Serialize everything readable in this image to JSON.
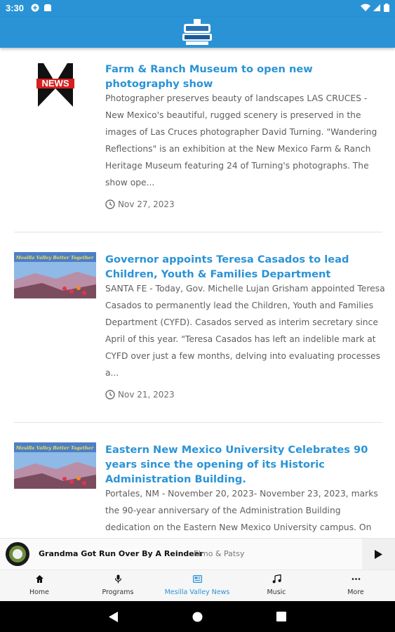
{
  "status": {
    "time": "3:30"
  },
  "articles": [
    {
      "title": "Farm & Ranch Museum to open new photography show",
      "excerpt": "Photographer preserves beauty of landscapes LAS CRUCES - New Mexico's beautiful, rugged scenery is preserved in the images of Las Cruces photographer David Turning. \"Wandering Reflections\" is an exhibition at the New Mexico Farm & Ranch Heritage Museum featuring 24 of Turning's photographs. The show ope...",
      "date": "Nov 27, 2023",
      "thumb_text": "NEWS"
    },
    {
      "title": "Governor appoints Teresa Casados to lead Children, Youth & Families Department",
      "excerpt": "SANTA FE - Today, Gov. Michelle Lujan Grisham appointed Teresa Casados to permanently lead the Children, Youth and Families Department (CYFD). Casados served as interim secretary since April of this year. \"Teresa Casados has left an indelible mark at CYFD over just a few months, delving into evaluating processes a...",
      "date": "Nov 21, 2023",
      "thumb_text": "Mesilla Valley Better Together"
    },
    {
      "title": "Eastern New Mexico University Celebrates 90 years since the opening of its Historic Administration Building.",
      "excerpt": "Portales, NM - November 20, 2023- November 23, 2023, marks the 90-year anniversary of the Administration Building dedication on the Eastern New Mexico University campus. On",
      "date": "",
      "thumb_text": "Mesilla Valley Better Together"
    }
  ],
  "player": {
    "title": "Grandma Got Run Over By A Reindeer",
    "artist": "Elmo & Patsy"
  },
  "nav": [
    {
      "label": "Home",
      "icon": "home-icon"
    },
    {
      "label": "Programs",
      "icon": "mic-icon"
    },
    {
      "label": "Mesilla Valley News",
      "icon": "news-icon"
    },
    {
      "label": "Music",
      "icon": "music-note-icon"
    },
    {
      "label": "More",
      "icon": "more-dots-icon"
    }
  ],
  "colors": {
    "accent": "#2a93d6"
  }
}
